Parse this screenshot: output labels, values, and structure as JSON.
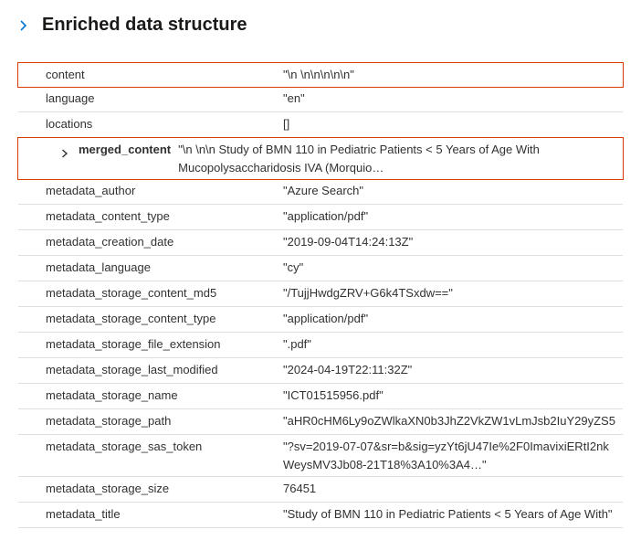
{
  "header": {
    "title": "Enriched data structure"
  },
  "rows": [
    {
      "key": "content",
      "value": "\"\\n \\n\\n\\n\\n\\n\"",
      "highlight": true
    },
    {
      "key": "language",
      "value": "\"en\""
    },
    {
      "key": "locations",
      "value": "[]"
    },
    {
      "key": "merged_content",
      "value": "\"\\n \\n\\n Study of BMN 110 in Pediatric Patients < 5 Years of Age With Mucopolysaccharidosis IVA (Morquio…",
      "nested": true,
      "highlight": true
    },
    {
      "key": "metadata_author",
      "value": "\"Azure Search\""
    },
    {
      "key": "metadata_content_type",
      "value": "\"application/pdf\""
    },
    {
      "key": "metadata_creation_date",
      "value": "\"2019-09-04T14:24:13Z\""
    },
    {
      "key": "metadata_language",
      "value": "\"cy\""
    },
    {
      "key": "metadata_storage_content_md5",
      "value": "\"/TujjHwdgZRV+G6k4TSxdw==\""
    },
    {
      "key": "metadata_storage_content_type",
      "value": "\"application/pdf\""
    },
    {
      "key": "metadata_storage_file_extension",
      "value": "\".pdf\""
    },
    {
      "key": "metadata_storage_last_modified",
      "value": "\"2024-04-19T22:11:32Z\""
    },
    {
      "key": "metadata_storage_name",
      "value": "\"ICT01515956.pdf\""
    },
    {
      "key": "metadata_storage_path",
      "value": "\"aHR0cHM6Ly9oZWlkaXN0b3JhZ2VkZW1vLmJsb2IuY29yZS5"
    },
    {
      "key": "metadata_storage_sas_token",
      "value": "\"?sv=2019-07-07&sr=b&sig=yzYt6jU47Ie%2F0ImavixiERtI2nkWeysMV3Jb08-21T18%3A10%3A4…\""
    },
    {
      "key": "metadata_storage_size",
      "value": "76451"
    },
    {
      "key": "metadata_title",
      "value": "\"Study of BMN 110 in Pediatric Patients < 5 Years of Age With\""
    }
  ]
}
